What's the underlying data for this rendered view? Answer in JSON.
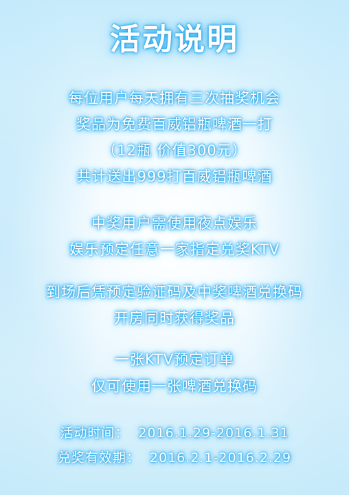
{
  "title": "活动说明",
  "paragraphs": [
    [
      "每位用户每天拥有三次抽奖机会",
      "奖品为免费百威铝瓶啤酒一打",
      "（12瓶  价值300元）",
      "共计送出999打百威铝瓶啤酒"
    ],
    [
      "中奖用户需使用夜点娱乐",
      "娱乐预定任意一家指定兑奖KTV"
    ],
    [
      "到场后凭预定验证码及中奖啤酒兑换码",
      "开房同时获得奖品"
    ],
    [
      "一张KTV预定订单",
      "仅可使用一张啤酒兑换码"
    ]
  ],
  "dates": {
    "activity_label": "活动时间：",
    "activity_value": "2016.1.29-2016.1.31",
    "redeem_label": "兑奖有效期：",
    "redeem_value": "2016.2.1-2016.2.29"
  },
  "colors": {
    "text": "#ffffff",
    "glow": "#1aa2ea",
    "background": "#e6f6fe"
  }
}
